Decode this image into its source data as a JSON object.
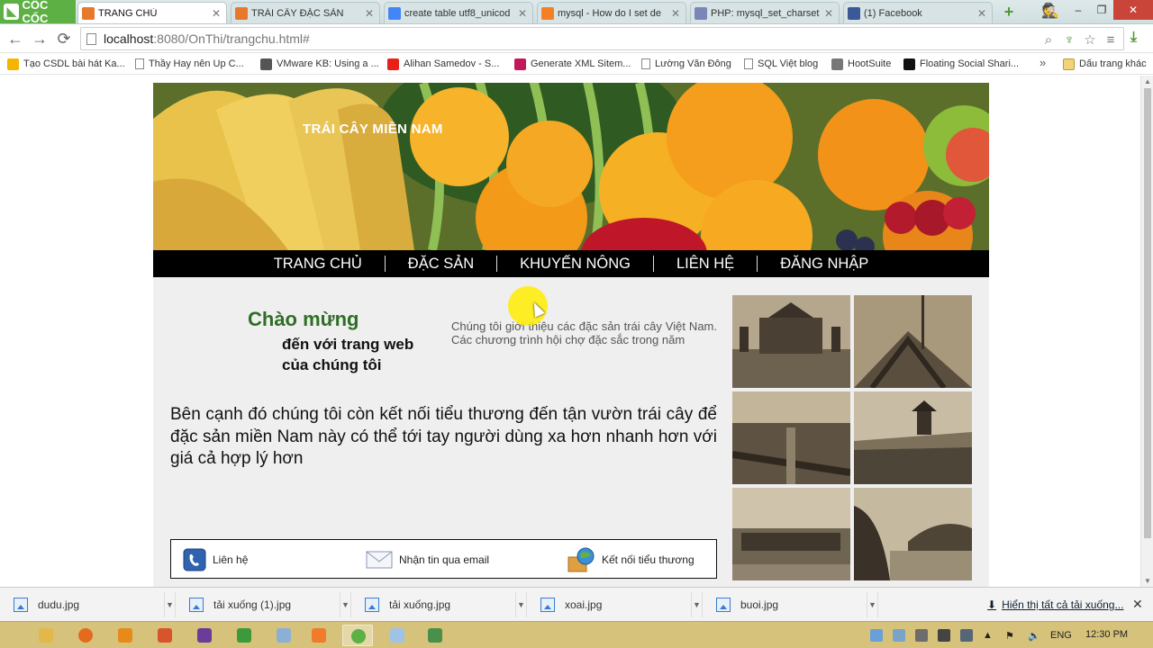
{
  "browser": {
    "brand": "CỐC CỐC",
    "tabs": [
      {
        "title": "TRANG CHỦ",
        "active": true,
        "favicon_color": "#e8782c"
      },
      {
        "title": "TRÁI CÂY ĐẶC SẢN",
        "active": false,
        "favicon_color": "#e8782c"
      },
      {
        "title": "create table utf8_unicod",
        "active": false,
        "favicon_color": "#4285f4"
      },
      {
        "title": "mysql - How do I set de",
        "active": false,
        "favicon_color": "#f48024"
      },
      {
        "title": "PHP: mysql_set_charset",
        "active": false,
        "favicon_color": "#7a86b8"
      },
      {
        "title": "(1) Facebook",
        "active": false,
        "favicon_color": "#3b5998"
      }
    ],
    "new_tab": "+",
    "window_controls": [
      "–",
      "❐",
      "✕"
    ],
    "url": {
      "host": "localhost",
      "path": ":8080/OnThi/trangchu.html#"
    },
    "nav": {
      "back": "←",
      "forward": "→",
      "reload": "⟳"
    },
    "url_icons": [
      "zoom-icon",
      "shield-icon",
      "star-icon",
      "menu-icon"
    ],
    "bookmarks": [
      {
        "label": "Tạo CSDL bài hát Ka...",
        "icon_color": "#f4b400"
      },
      {
        "label": "Thầy Hay nên Up C...",
        "icon_color": "page"
      },
      {
        "label": "VMware KB: Using a ...",
        "icon_color": "#555555"
      },
      {
        "label": "Alihan Samedov - S...",
        "icon_color": "#e62117"
      },
      {
        "label": "Generate XML Sitem...",
        "icon_color": "#c2185b"
      },
      {
        "label": "Lường Văn Đông",
        "icon_color": "page"
      },
      {
        "label": "SQL Việt blog",
        "icon_color": "page"
      },
      {
        "label": "HootSuite",
        "icon_color": "#777777"
      },
      {
        "label": "Floating Social Shari...",
        "icon_color": "#111111"
      }
    ],
    "bookmarks_more": "»",
    "bookmarks_folder": "Dấu trang khác"
  },
  "site": {
    "banner_title": "TRÁI CÂY MIỀN NAM",
    "menu": [
      "TRANG CHỦ",
      "ĐẶC SẢN",
      "KHUYẾN NÔNG",
      "LIÊN HỆ",
      "ĐĂNG NHẬP"
    ],
    "welcome_heading": "Chào mừng",
    "welcome_sub": "đến với trang web của chúng tôi",
    "intro": "Chúng tôi giới thiệu các đặc sản trái cây Việt Nam. Các chương trình hội chợ đặc sắc trong năm",
    "body": "Bên cạnh đó chúng tôi còn kết nối tiểu thương đến tận vườn trái cây để đặc sản miền Nam này có thể tới tay người dùng xa hơn nhanh hơn với giá cả hợp lý hơn",
    "contact_items": [
      {
        "label": "Liên hệ",
        "icon": "phone-icon"
      },
      {
        "label": "Nhận tin qua email",
        "icon": "email-icon"
      },
      {
        "label": "Kết nối tiểu thương",
        "icon": "globe-box-icon"
      }
    ],
    "gallery_count": 6
  },
  "downloads": {
    "items": [
      "dudu.jpg",
      "tải xuống (1).jpg",
      "tải xuống.jpg",
      "xoai.jpg",
      "buoi.jpg"
    ],
    "show_all": "Hiển thị tất cả tải xuống...",
    "close": "✕"
  },
  "taskbar": {
    "language": "ENG",
    "time": "12:30 PM"
  },
  "colors": {
    "brand_green": "#5db043",
    "heading_green": "#2f6e26",
    "menu_bg": "#000000",
    "taskbar": "#d6c27a"
  }
}
